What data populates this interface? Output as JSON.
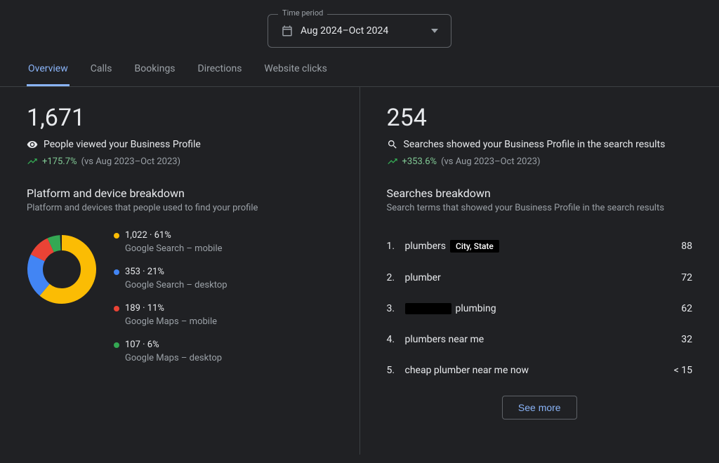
{
  "time_period": {
    "legend": "Time period",
    "value": "Aug 2024–Oct 2024"
  },
  "tabs": [
    {
      "label": "Overview",
      "active": true
    },
    {
      "label": "Calls"
    },
    {
      "label": "Bookings"
    },
    {
      "label": "Directions"
    },
    {
      "label": "Website clicks"
    }
  ],
  "views": {
    "total": "1,671",
    "label": "People viewed your Business Profile",
    "trend_pct": "+175.7%",
    "trend_compare": "(vs Aug 2023–Oct 2023)",
    "breakdown_title": "Platform and device breakdown",
    "breakdown_sub": "Platform and devices that people used to find your profile",
    "segments": [
      {
        "value": "1,022",
        "pct": "61%",
        "label": "Google Search – mobile",
        "color": "#fbbc04",
        "frac": 0.61
      },
      {
        "value": "353",
        "pct": "21%",
        "label": "Google Search – desktop",
        "color": "#4285f4",
        "frac": 0.21
      },
      {
        "value": "189",
        "pct": "11%",
        "label": "Google Maps – mobile",
        "color": "#ea4335",
        "frac": 0.11
      },
      {
        "value": "107",
        "pct": "6%",
        "label": "Google Maps – desktop",
        "color": "#34a853",
        "frac": 0.06
      }
    ]
  },
  "searches": {
    "total": "254",
    "label": "Searches showed your Business Profile in the search results",
    "trend_pct": "+353.6%",
    "trend_compare": "(vs Aug 2023–Oct 2023)",
    "breakdown_title": "Searches breakdown",
    "breakdown_sub": "Search terms that showed your Business Profile in the search results",
    "terms": [
      {
        "rank": "1.",
        "prefix": "plumbers",
        "redacted": "City, State",
        "suffix": "",
        "count": "88"
      },
      {
        "rank": "2.",
        "prefix": "plumber",
        "redacted": "",
        "suffix": "",
        "count": "72"
      },
      {
        "rank": "3.",
        "prefix": "",
        "redacted": " ",
        "suffix": "plumbing",
        "count": "62"
      },
      {
        "rank": "4.",
        "prefix": "plumbers near me",
        "redacted": "",
        "suffix": "",
        "count": "32"
      },
      {
        "rank": "5.",
        "prefix": "cheap plumber near me now",
        "redacted": "",
        "suffix": "",
        "count": "< 15"
      }
    ],
    "see_more": "See more"
  },
  "chart_data": {
    "type": "pie",
    "title": "Platform and device breakdown",
    "categories": [
      "Google Search – mobile",
      "Google Search – desktop",
      "Google Maps – mobile",
      "Google Maps – desktop"
    ],
    "values": [
      1022,
      353,
      189,
      107
    ],
    "percentages": [
      61,
      21,
      11,
      6
    ],
    "colors": [
      "#fbbc04",
      "#4285f4",
      "#ea4335",
      "#34a853"
    ]
  }
}
